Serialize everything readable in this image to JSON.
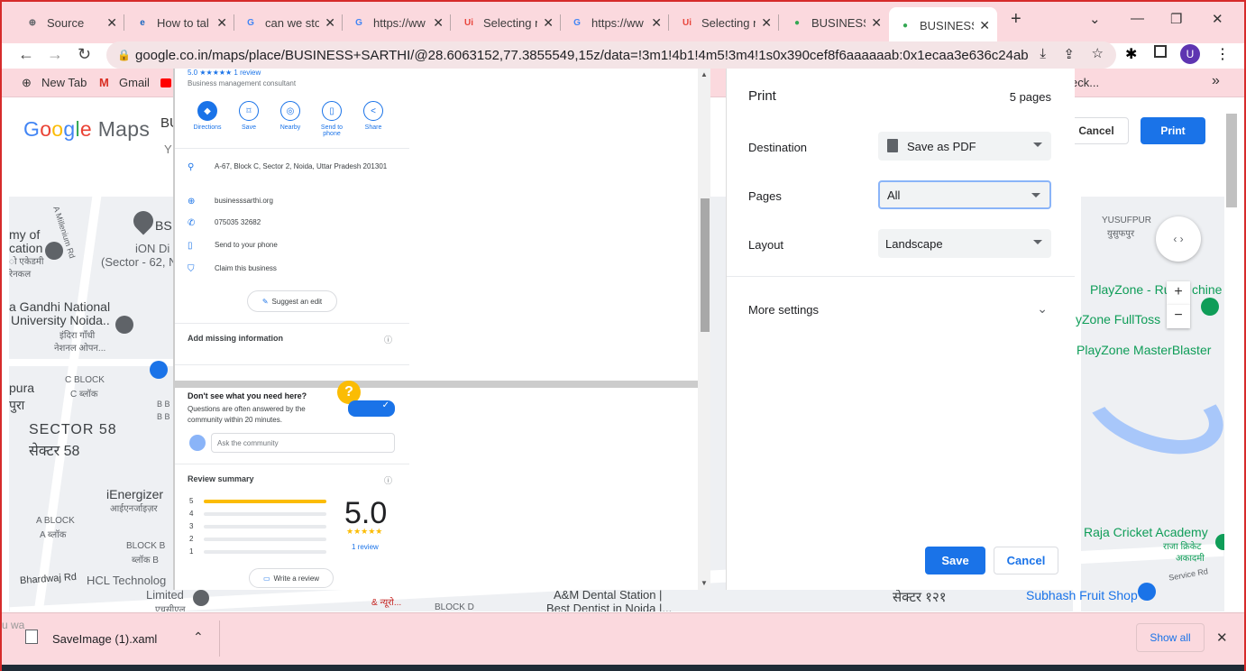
{
  "tabs": [
    {
      "title": "Source",
      "icon": "globe-icon",
      "fav_color": "#5f6368",
      "glyph": "⊕"
    },
    {
      "title": "How to tal",
      "icon": "e-logo-icon",
      "fav_color": "#1565c0",
      "glyph": "e"
    },
    {
      "title": "can we sto",
      "icon": "google-icon",
      "fav_color": "#4285f4",
      "glyph": "G"
    },
    {
      "title": "https://ww",
      "icon": "google-icon",
      "fav_color": "#4285f4",
      "glyph": "G"
    },
    {
      "title": "Selecting n",
      "icon": "ui-icon",
      "fav_color": "#e8453c",
      "glyph": "Ui"
    },
    {
      "title": "https://ww",
      "icon": "google-icon",
      "fav_color": "#4285f4",
      "glyph": "G"
    },
    {
      "title": "Selecting n",
      "icon": "ui-icon",
      "fav_color": "#e8453c",
      "glyph": "Ui"
    },
    {
      "title": "BUSINESS",
      "icon": "maps-pin-icon",
      "fav_color": "#34a853",
      "glyph": "●"
    },
    {
      "title": "BUSINESS",
      "icon": "maps-pin-icon",
      "fav_color": "#34a853",
      "glyph": "●"
    }
  ],
  "new_tab": "+",
  "address": "google.co.in/maps/place/BUSINESS+SARTHI/@28.6063152,77.3855549,15z/data=!3m1!4b1!4m5!3m4!1s0x390cef8f6aaaaaab:0x1ecaa3e636c24ab9!8m2!3d28....",
  "bookmarks": {
    "new_tab": "New Tab",
    "gmail": "Gmail",
    "overflow": "eck...",
    "more": "»"
  },
  "profile_initial": "U",
  "maps": {
    "logo": "Google Maps",
    "partial_title": "BU",
    "partial_sub": "Y"
  },
  "listing": {
    "rating_line": "5.0 ★★★★★  1 review",
    "category": "Business management consultant",
    "actions": [
      "Directions",
      "Save",
      "Nearby",
      "Send to phone",
      "Share"
    ],
    "address": "A-67, Block C, Sector 2, Noida, Uttar Pradesh 201301",
    "website": "businesssarthi.org",
    "phone": "075035 32682",
    "send_phone": "Send to your phone",
    "claim": "Claim this business",
    "suggest": "Suggest an edit",
    "missing": "Add missing information",
    "qa_title": "Don't see what you need here?",
    "qa_text": "Questions are often answered by the community within 20 minutes.",
    "ask_placeholder": "Ask the community",
    "review_summary": "Review summary",
    "score": "5.0",
    "stars": "★★★★★",
    "reviews": "1 review",
    "write_review": "Write a review",
    "bar_labels": [
      "5",
      "4",
      "3",
      "2",
      "1"
    ],
    "bar_fill": [
      1,
      0,
      0,
      0,
      0
    ]
  },
  "print": {
    "title": "Print",
    "pages_count": "5 pages",
    "destination_label": "Destination",
    "destination_value": "Save as PDF",
    "pages_label": "Pages",
    "pages_value": "All",
    "layout_label": "Layout",
    "layout_value": "Landscape",
    "more_settings": "More settings",
    "save": "Save",
    "cancel": "Cancel"
  },
  "maps_buttons": {
    "cancel": "Cancel",
    "print": "Print"
  },
  "map_labels": {
    "l1": "my of",
    "l2": "cation",
    "l3": "ो एकेडमी",
    "l4": "रेनकल",
    "l5": "a Gandhi National",
    "l6": "University Noida..",
    "l7": "इंदिरा गाँधी",
    "l8": "नेशनल ओपन...",
    "l9": "BS",
    "l10": "iON Di",
    "l11": "(Sector - 62, N",
    "l12": "A Millenium Rd",
    "l13": "C BLOCK",
    "l14": "C ब्लॉक",
    "l15": "pura",
    "l16": "पुरा",
    "l17": "SECTOR 58",
    "l18": "सेक्टर 58",
    "l19": "iEnergizer",
    "l20": "आईएनर्जाइज़र",
    "l21": "A BLOCK",
    "l22": "A ब्लॉक",
    "l23": "BLOCK B",
    "l24": "ब्लॉक B",
    "l25": "Bhardwaj Rd",
    "l26": "HCL Technolog",
    "l27": "Limited",
    "l28": "एचसीएल",
    "l29": "BLOCK D",
    "l30": "A&M Dental Station |",
    "l31": "Best Dentist in Noida |...",
    "l32": "सेक्टर १२१",
    "l33": "& न्यूरो...",
    "l34": "YUSUFPUR",
    "l35": "युसुफपुर",
    "l36": "PlayZone - Rur",
    "l37": "chine",
    "l38": "yZone FullToss",
    "l39": "PlayZone MasterBlaster",
    "l40": "Raja Cricket Academy",
    "l41": "राजा क्रिकेट",
    "l42": "अकादमी",
    "l43": "Subhash Fruit Shop",
    "l44": "Service Rd",
    "l45": "B B",
    "l46": "B B"
  },
  "download": {
    "file": "SaveImage (1).xaml",
    "show_all": "Show all",
    "ghost": "u wa"
  }
}
